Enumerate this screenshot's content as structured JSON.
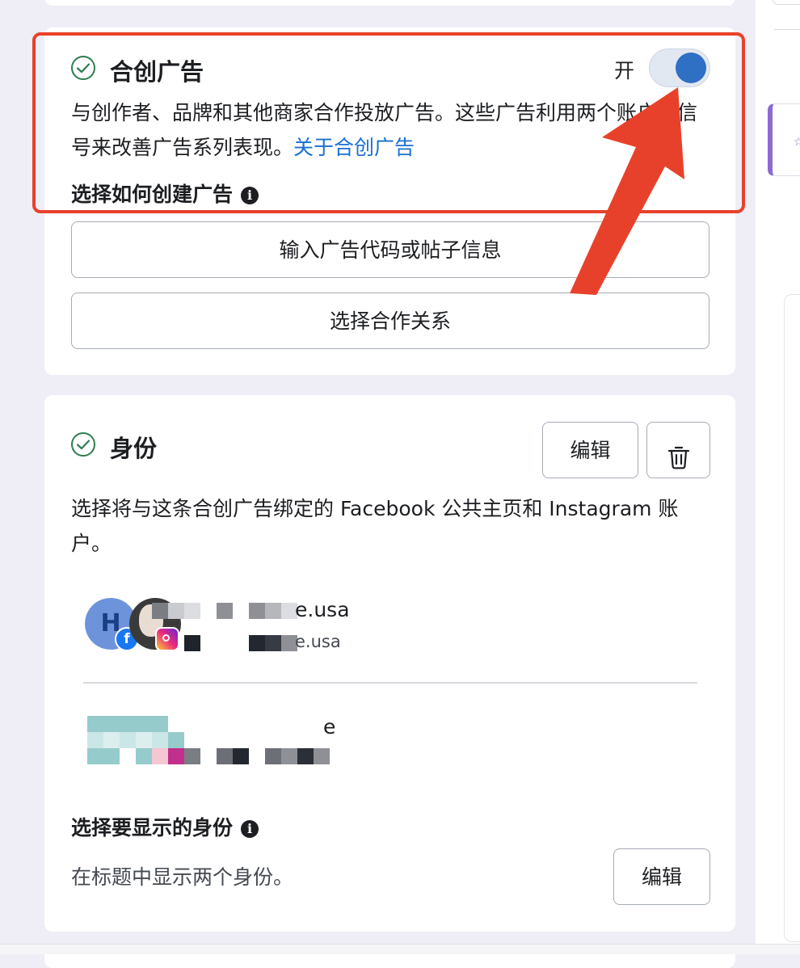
{
  "colors": {
    "accent_blue": "#1a6fd1",
    "toggle_on": "#2f6fc4",
    "check_green": "#2e7d52",
    "highlight_red": "#e8412b",
    "text_primary": "#1c1e21"
  },
  "collab_card": {
    "title": "合创广告",
    "toggle_label": "开",
    "toggle_on": true,
    "description": "与创作者、品牌和其他商家合作投放广告。这些广告利用两个账户的信号来改善广告系列表现。",
    "learn_more_link": "关于合创广告",
    "choose_label": "选择如何创建广告",
    "option_buttons": [
      "输入广告代码或帖子信息",
      "选择合作关系"
    ],
    "icons": [
      "check-circle-icon",
      "info-icon",
      "annotation-arrow"
    ]
  },
  "identity_card": {
    "title": "身份",
    "edit_button": "编辑",
    "delete_icon": "trash-icon",
    "description": "选择将与这条合创广告绑定的 Facebook 公共主页和 Instagram 账户。",
    "accounts": [
      {
        "avatar_letter": "H",
        "name_visible": "e.usa",
        "handle_visible": "e.usa",
        "badges": [
          "facebook-icon",
          "instagram-icon"
        ]
      },
      {
        "name_visible": "e"
      }
    ],
    "display_section_title": "选择要显示的身份",
    "display_description": "在标题中显示两个身份。",
    "display_edit_button": "编辑"
  }
}
